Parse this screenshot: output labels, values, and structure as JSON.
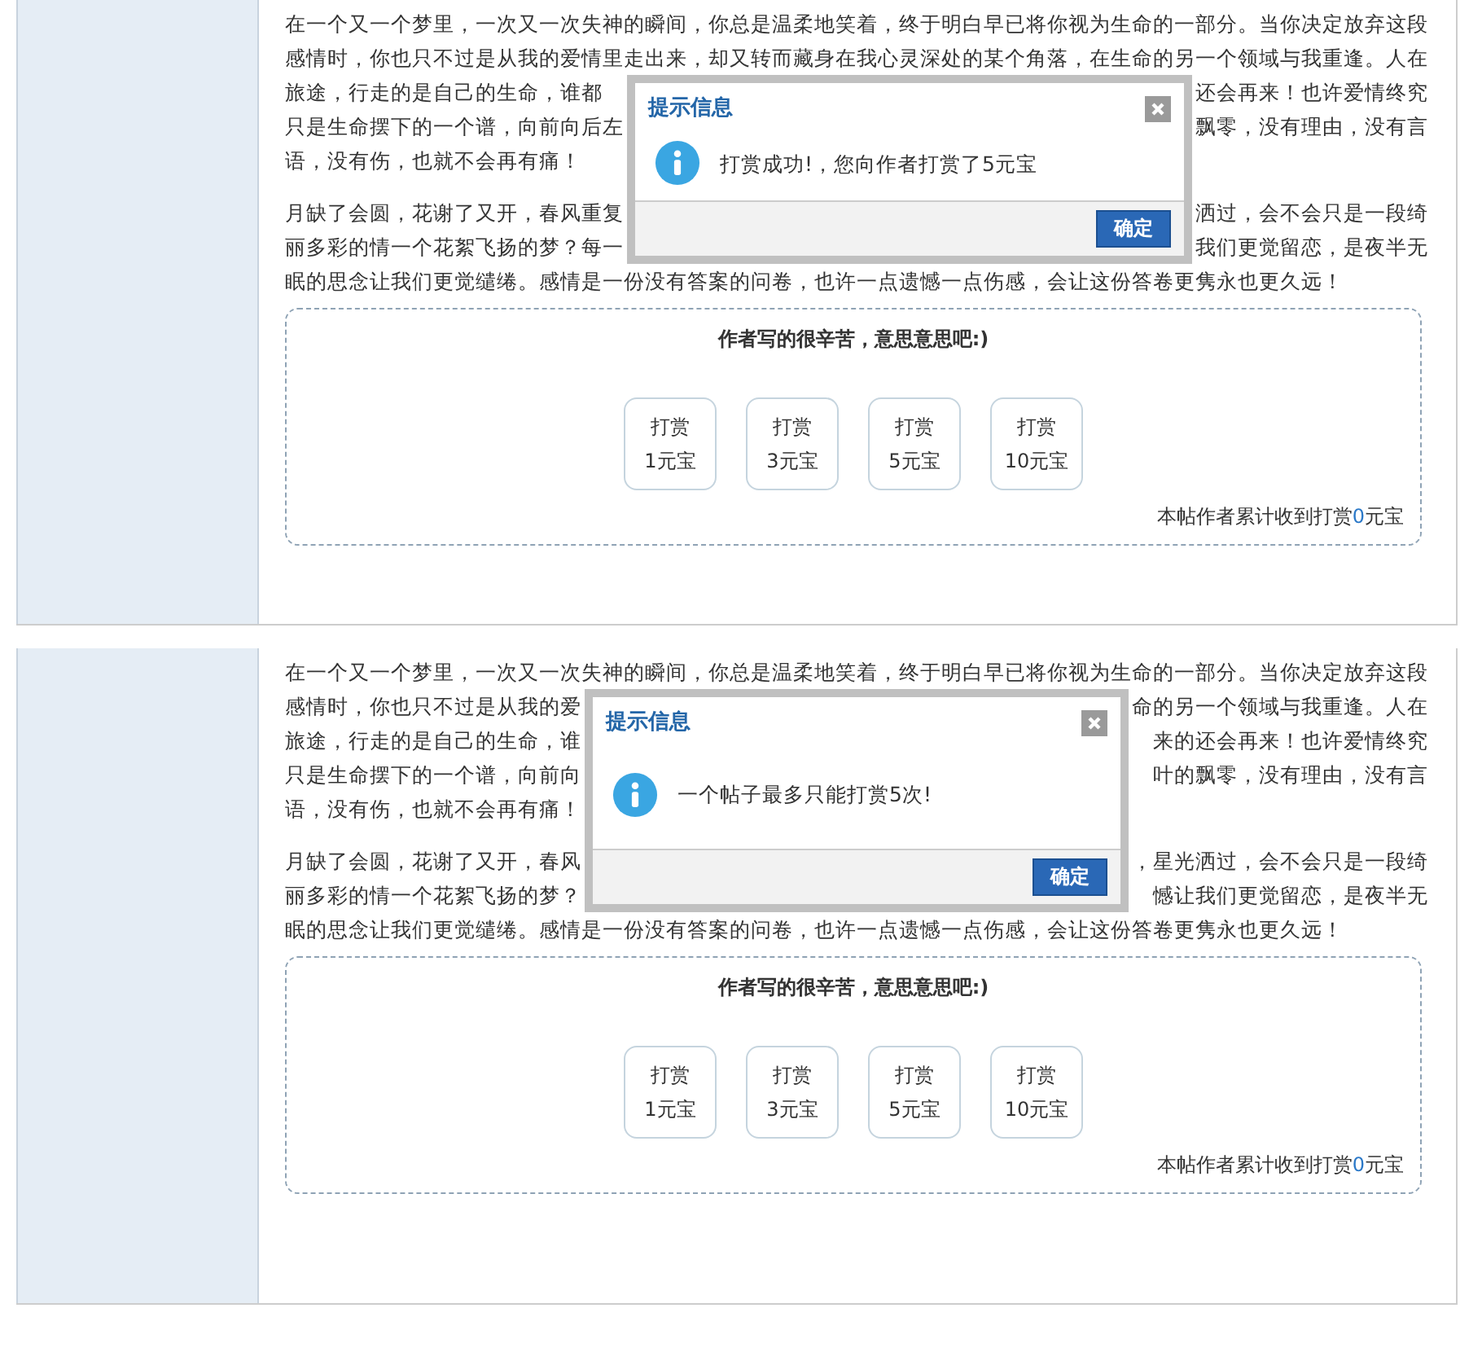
{
  "posts": [
    {
      "paragraphs": [
        [
          {
            "kind": "full",
            "text": "在一个又一个梦里，一次又一次失神的瞬间，你总是温柔地笑着，终于明白早已将你视为生命的一部分。当你决定放弃这段"
          },
          {
            "kind": "full",
            "text": "感情时，你也只不过是从我的爱情里走出来，却又转而藏身在我心灵深处的某个角落，在生命的另一个领域与我重逢。人在"
          },
          {
            "kind": "split",
            "left": "旅途，行走的是自己的生命，谁都",
            "right": "还会再来！也许爱情终究"
          },
          {
            "kind": "split",
            "left": "只是生命摆下的一个谱，向前向后左",
            "right": "飘零，没有理由，没有言"
          },
          {
            "kind": "full",
            "text": "语，没有伤，也就不会再有痛！"
          }
        ],
        [
          {
            "kind": "split",
            "left": "月缺了会圆，花谢了又开，春风重复",
            "right": "洒过，会不会只是一段绮"
          },
          {
            "kind": "split",
            "left": "丽多彩的情一个花絮飞扬的梦？每一",
            "right": "我们更觉留恋，是夜半无"
          },
          {
            "kind": "full",
            "text": "眠的思念让我们更觉缱绻。感情是一份没有答案的问卷，也许一点遗憾一点伤感，会让这份答卷更隽永也更久远！"
          }
        ]
      ],
      "dialog": {
        "title": "提示信息",
        "message": "打赏成功!，您向作者打赏了5元宝",
        "button": "确定"
      },
      "reward": {
        "title": "作者写的很辛苦，意思意思吧:)",
        "options": [
          {
            "label": "打赏",
            "amount": "1元宝"
          },
          {
            "label": "打赏",
            "amount": "3元宝"
          },
          {
            "label": "打赏",
            "amount": "5元宝"
          },
          {
            "label": "打赏",
            "amount": "10元宝"
          }
        ],
        "total_prefix": "本帖作者累计收到打赏",
        "total_amount": "0",
        "total_suffix": "元宝"
      }
    },
    {
      "paragraphs": [
        [
          {
            "kind": "full",
            "text": "在一个又一个梦里，一次又一次失神的瞬间，你总是温柔地笑着，终于明白早已将你视为生命的一部分。当你决定放弃这段"
          },
          {
            "kind": "split",
            "left": "感情时，你也只不过是从我的爱",
            "right": "命的另一个领域与我重逢。人在"
          },
          {
            "kind": "split",
            "left": "旅途，行走的是自己的生命，谁",
            "right": "来的还会再来！也许爱情终究"
          },
          {
            "kind": "split",
            "left": "只是生命摆下的一个谱，向前向",
            "right": "叶的飘零，没有理由，没有言"
          },
          {
            "kind": "full",
            "text": "语，没有伤，也就不会再有痛！"
          }
        ],
        [
          {
            "kind": "split",
            "left": "月缺了会圆，花谢了又开，春风",
            "right": "，星光洒过，会不会只是一段绮"
          },
          {
            "kind": "split",
            "left": "丽多彩的情一个花絮飞扬的梦？",
            "right": "憾让我们更觉留恋，是夜半无"
          },
          {
            "kind": "full",
            "text": "眠的思念让我们更觉缱绻。感情是一份没有答案的问卷，也许一点遗憾一点伤感，会让这份答卷更隽永也更久远！"
          }
        ]
      ],
      "dialog": {
        "title": "提示信息",
        "message": "一个帖子最多只能打赏5次!",
        "button": "确定"
      },
      "reward": {
        "title": "作者写的很辛苦，意思意思吧:)",
        "options": [
          {
            "label": "打赏",
            "amount": "1元宝"
          },
          {
            "label": "打赏",
            "amount": "3元宝"
          },
          {
            "label": "打赏",
            "amount": "5元宝"
          },
          {
            "label": "打赏",
            "amount": "10元宝"
          }
        ],
        "total_prefix": "本帖作者累计收到打赏",
        "total_amount": "0",
        "total_suffix": "元宝"
      }
    }
  ]
}
